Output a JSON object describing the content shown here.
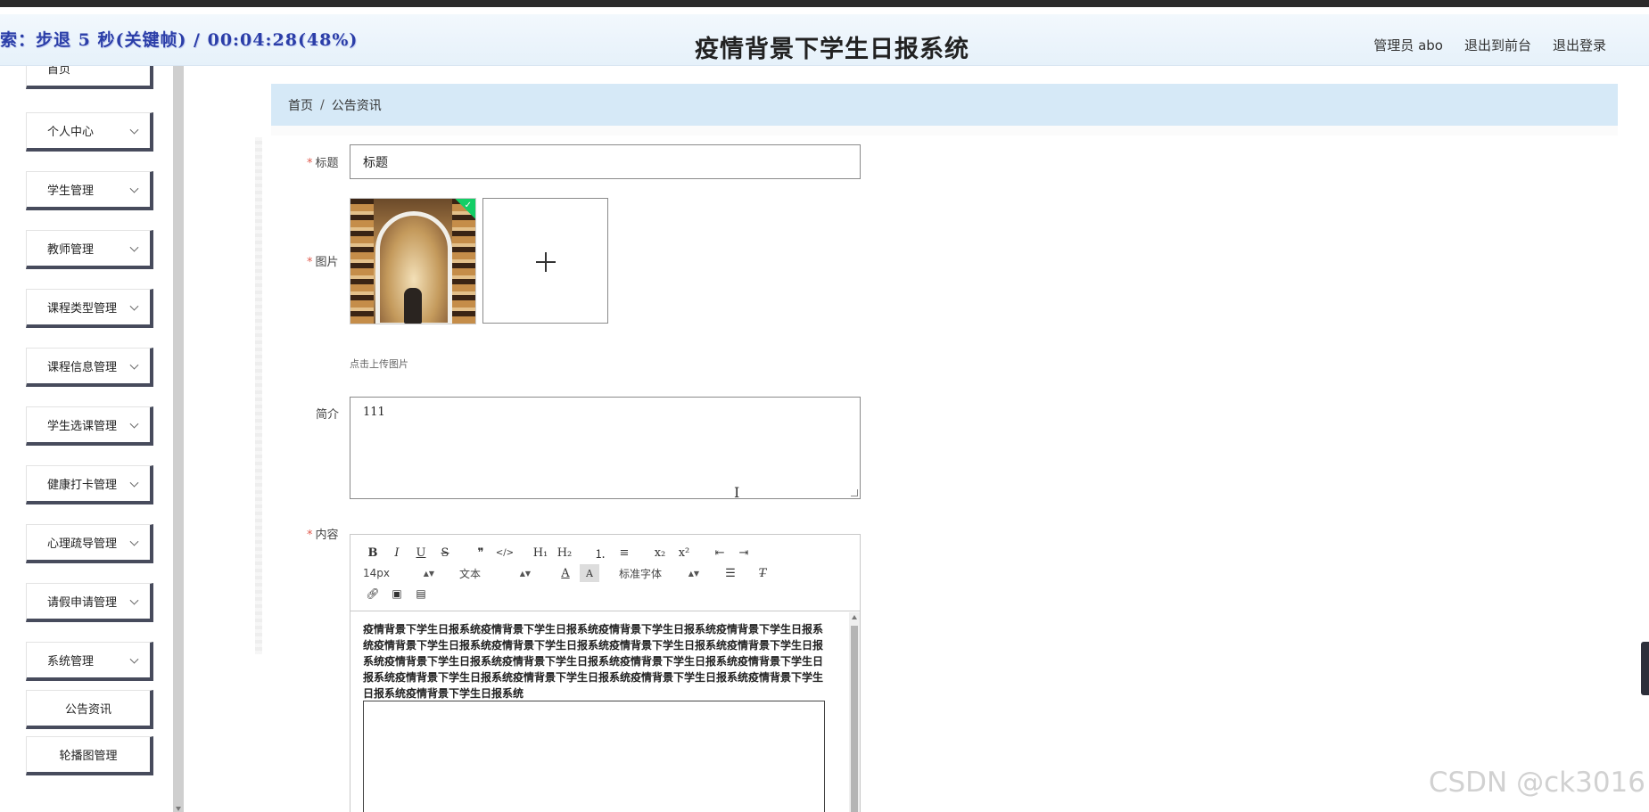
{
  "recorder": {
    "status": "索：步退 5 秒(关键帧) / 00:04:28(48%)"
  },
  "header": {
    "title": "疫情背景下学生日报系统",
    "user_label": "管理员 abo",
    "exit_front": "退出到前台",
    "logout": "退出登录"
  },
  "sidebar": {
    "items": [
      {
        "label": "首页",
        "expandable": false
      },
      {
        "label": "个人中心",
        "expandable": true
      },
      {
        "label": "学生管理",
        "expandable": true
      },
      {
        "label": "教师管理",
        "expandable": true
      },
      {
        "label": "课程类型管理",
        "expandable": true
      },
      {
        "label": "课程信息管理",
        "expandable": true
      },
      {
        "label": "学生选课管理",
        "expandable": true
      },
      {
        "label": "健康打卡管理",
        "expandable": true
      },
      {
        "label": "心理疏导管理",
        "expandable": true
      },
      {
        "label": "请假申请管理",
        "expandable": true
      },
      {
        "label": "系统管理",
        "expandable": true
      }
    ],
    "sub_items": [
      {
        "label": "公告资讯"
      },
      {
        "label": "轮播图管理"
      }
    ]
  },
  "breadcrumb": {
    "home": "首页",
    "separator": "/",
    "current": "公告资讯"
  },
  "form": {
    "title_label": "标题",
    "title_value": "标题",
    "image_label": "图片",
    "upload_hint": "点击上传图片",
    "intro_label": "简介",
    "intro_value": "111",
    "content_label": "内容",
    "required_mark": "*"
  },
  "editor": {
    "toolbar_row1": [
      "B",
      "I",
      "U",
      "S",
      "❞",
      "</>",
      "H₁",
      "H₂",
      "⒈",
      "≡",
      "x₂",
      "x²",
      "⇤",
      "⇥"
    ],
    "font_size": "14px",
    "text_style": "文本",
    "font_family": "标准字体",
    "content": "疫情背景下学生日报系统疫情背景下学生日报系统疫情背景下学生日报系统疫情背景下学生日报系统疫情背景下学生日报系统疫情背景下学生日报系统疫情背景下学生日报系统疫情背景下学生日报系统疫情背景下学生日报系统疫情背景下学生日报系统疫情背景下学生日报系统疫情背景下学生日报系统疫情背景下学生日报系统疫情背景下学生日报系统疫情背景下学生日报系统疫情背景下学生日报系统疫情背景下学生日报系统"
  },
  "watermark": "CSDN @ck3016",
  "colors": {
    "breadcrumb_bg": "#d6e9f7",
    "sidebar_shadow": "#474b5c",
    "required": "#e05a4d",
    "upload_success": "#13ce66"
  }
}
